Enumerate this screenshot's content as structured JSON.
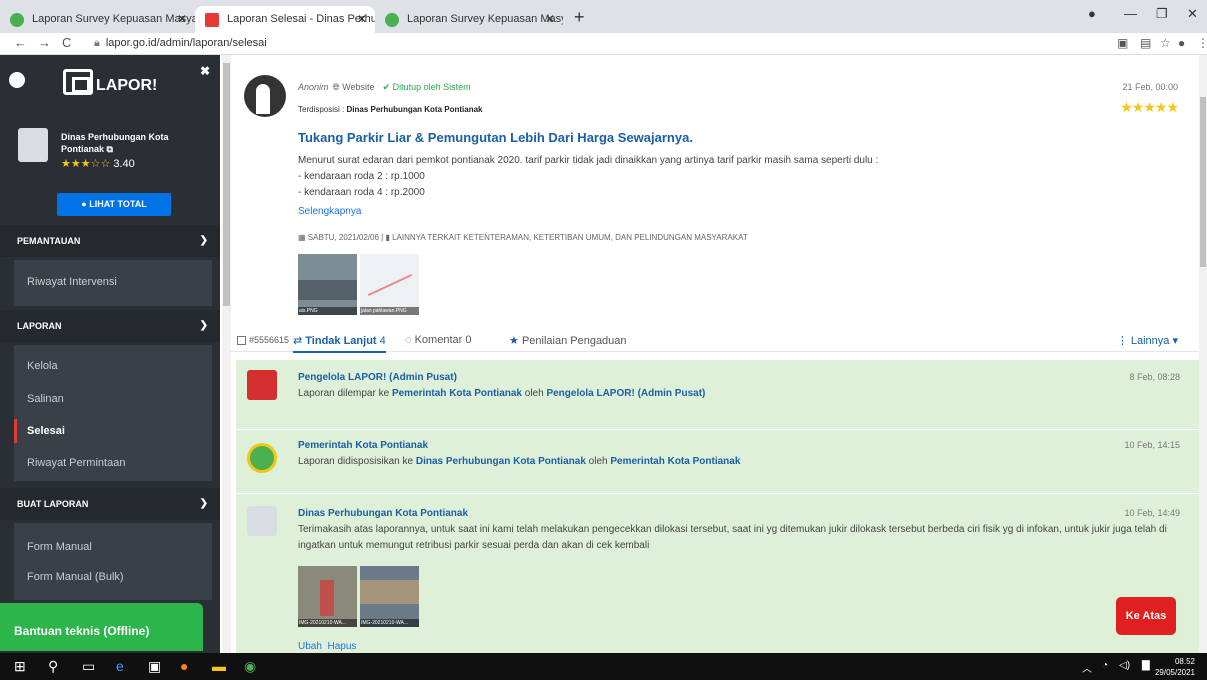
{
  "browser": {
    "tabs": [
      {
        "title": "Laporan Survey Kepuasan Masya",
        "active": false
      },
      {
        "title": "Laporan Selesai - Dinas Perhubu",
        "active": true
      },
      {
        "title": "Laporan Survey Kepuasan Masya",
        "active": false
      }
    ],
    "url": "lapor.go.id/admin/laporan/selesai"
  },
  "sidebar": {
    "logo": "LAPOR!",
    "org_name": "Dinas Perhubungan Kota Pontianak",
    "rating_stars": "★★★☆☆",
    "rating_value": "3.40",
    "lihat_total": "LIHAT TOTAL",
    "sections": [
      {
        "title": "PEMANTAUAN",
        "items": [
          "Riwayat Intervensi"
        ]
      },
      {
        "title": "LAPORAN",
        "items": [
          "Kelola",
          "Salinan",
          "Selesai",
          "Riwayat Permintaan"
        ]
      },
      {
        "title": "BUAT LAPORAN",
        "items": [
          "Form Manual",
          "Form Manual (Bulk)"
        ]
      }
    ],
    "active_item": "Selesai",
    "bantuan": "Bantuan teknis (Offline)"
  },
  "report": {
    "author": "Anonim",
    "source": "Website",
    "status": "Ditutup oleh Sistem",
    "date": "21 Feb, 00:00",
    "terdisposisi_label": "Terdisposisi :",
    "terdisposisi": "Dinas Perhubungan Kota Pontianak",
    "title": "Tukang Parkir Liar & Pemungutan Lebih Dari Harga Sewajarnya.",
    "body_lines": [
      "Menurut surat edaran dari pemkot pontianak 2020. tarif parkir tidak jadi dinaikkan yang artinya tarif parkir masih sama seperti dulu :",
      "- kendaraan roda 2 : rp.1000",
      "- kendaraan roda 4 : rp.2000"
    ],
    "more": "Selengkapnya",
    "date_line": "SABTU, 2021/02/06",
    "category": "LAINNYA TERKAIT KETENTERAMAN, KETERTIBAN UMUM, DAN PELINDUNGAN MASYARAKAT",
    "attachments": [
      "ais.PNG",
      "jalan pahlawan.PNG"
    ],
    "rating": 5
  },
  "tabs": {
    "id": "#5556615",
    "tindak_lanjut": "Tindak Lanjut",
    "tindak_lanjut_count": "4",
    "komentar": "Komentar 0",
    "penilaian": "Penilaian Pengaduan",
    "lainnya": "Lainnya"
  },
  "followups": [
    {
      "name": "Pengelola LAPOR! (Admin Pusat)",
      "date": "8 Feb, 08:28",
      "text_a": "Laporan dilempar ke ",
      "b1": "Pemerintah Kota Pontianak",
      "text_b": " oleh ",
      "b2": "Pengelola LAPOR! (Admin Pusat)"
    },
    {
      "name": "Pemerintah Kota Pontianak",
      "date": "10 Feb, 14:15",
      "text_a": "Laporan didisposisikan ke ",
      "b1": "Dinas Perhubungan Kota Pontianak",
      "text_b": " oleh ",
      "b2": "Pemerintah Kota Pontianak"
    },
    {
      "name": "Dinas Perhubungan Kota Pontianak",
      "date": "10 Feb, 14:49",
      "text": "Terimakasih atas laporannya, untuk saat ini kami telah melakukan pengecekkan dilokasi tersebut, saat ini yg ditemukan jukir dilokask tersebut berbeda ciri fisik yg di infokan, untuk jukir juga telah di ingatkan untuk memungut retribusi parkir sesuai perda dan akan di cek kembali",
      "attachments": [
        "IMG-20210210-WA...",
        "IMG-20210210-WA..."
      ]
    }
  ],
  "actions": {
    "ubah": "Ubah",
    "hapus": "Hapus",
    "ke_atas": "Ke Atas"
  },
  "taskbar": {
    "time": "08.52",
    "date": "29/05/2021"
  }
}
